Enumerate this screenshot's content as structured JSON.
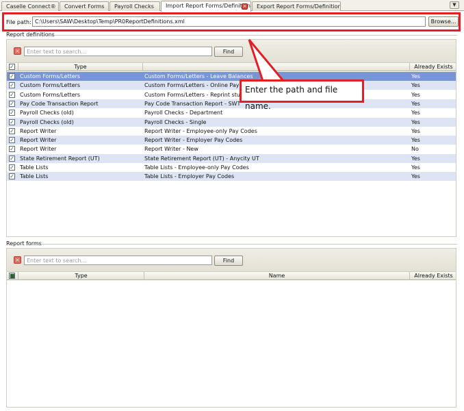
{
  "tabs": [
    {
      "label": "Caselle Connect®"
    },
    {
      "label": "Convert Forms"
    },
    {
      "label": "Payroll Checks"
    },
    {
      "label": "Import Report Forms/Definitions"
    },
    {
      "label": "Export Report Forms/Definitions"
    }
  ],
  "icons": {
    "tab_close": "close-icon",
    "tab_menu": "chevron-down-icon",
    "clear_search": "clear-icon",
    "checkbox": "checkbox-icon"
  },
  "file_path": {
    "label": "File path:",
    "value": "C:\\Users\\SAW\\Desktop\\Temp\\PR0ReportDefinitions.xml",
    "browse_label": "Browse..."
  },
  "report_definitions": {
    "title": "Report definitions",
    "search_placeholder": "Enter text to search...",
    "find_label": "Find",
    "columns": {
      "type": "Type",
      "name": "",
      "exists": "Already Exists"
    },
    "rows": [
      {
        "type": "Custom Forms/Letters",
        "name": "Custom Forms/Letters - Leave Balances",
        "exists": "Yes",
        "checked": true
      },
      {
        "type": "Custom Forms/Letters",
        "name": "Custom Forms/Letters - Online Pay Vouch",
        "exists": "Yes",
        "checked": true
      },
      {
        "type": "Custom Forms/Letters",
        "name": "Custom Forms/Letters - Reprint stub",
        "exists": "Yes",
        "checked": true
      },
      {
        "type": "Pay Code Transaction Report",
        "name": "Pay Code Transaction Report - SWT",
        "exists": "Yes",
        "checked": true
      },
      {
        "type": "Payroll Checks (old)",
        "name": "Payroll Checks - Department",
        "exists": "Yes",
        "checked": true
      },
      {
        "type": "Payroll Checks (old)",
        "name": "Payroll Checks - Single",
        "exists": "Yes",
        "checked": true
      },
      {
        "type": "Report Writer",
        "name": "Report Writer - Employee-only Pay Codes",
        "exists": "Yes",
        "checked": true
      },
      {
        "type": "Report Writer",
        "name": "Report Writer - Employer Pay Codes",
        "exists": "Yes",
        "checked": true
      },
      {
        "type": "Report Writer",
        "name": "Report Writer - New",
        "exists": "No",
        "checked": true
      },
      {
        "type": "State Retirement Report (UT)",
        "name": "State Retirement Report (UT) - Anycity UT",
        "exists": "Yes",
        "checked": true
      },
      {
        "type": "Table Lists",
        "name": "Table Lists - Employee-only Pay Codes",
        "exists": "Yes",
        "checked": true
      },
      {
        "type": "Table Lists",
        "name": "Table Lists - Employer Pay Codes",
        "exists": "Yes",
        "checked": true
      }
    ]
  },
  "report_forms": {
    "title": "Report forms",
    "search_placeholder": "Enter text to search...",
    "find_label": "Find",
    "columns": {
      "type": "Type",
      "name": "Name",
      "exists": "Already Exists"
    }
  },
  "callout": {
    "text": "Enter the path and file name.",
    "color": "#e01f26"
  },
  "colors": {
    "selected_row": "#7a95d3",
    "alt_row": "#dde5f5",
    "accent_red": "#e01f26"
  }
}
